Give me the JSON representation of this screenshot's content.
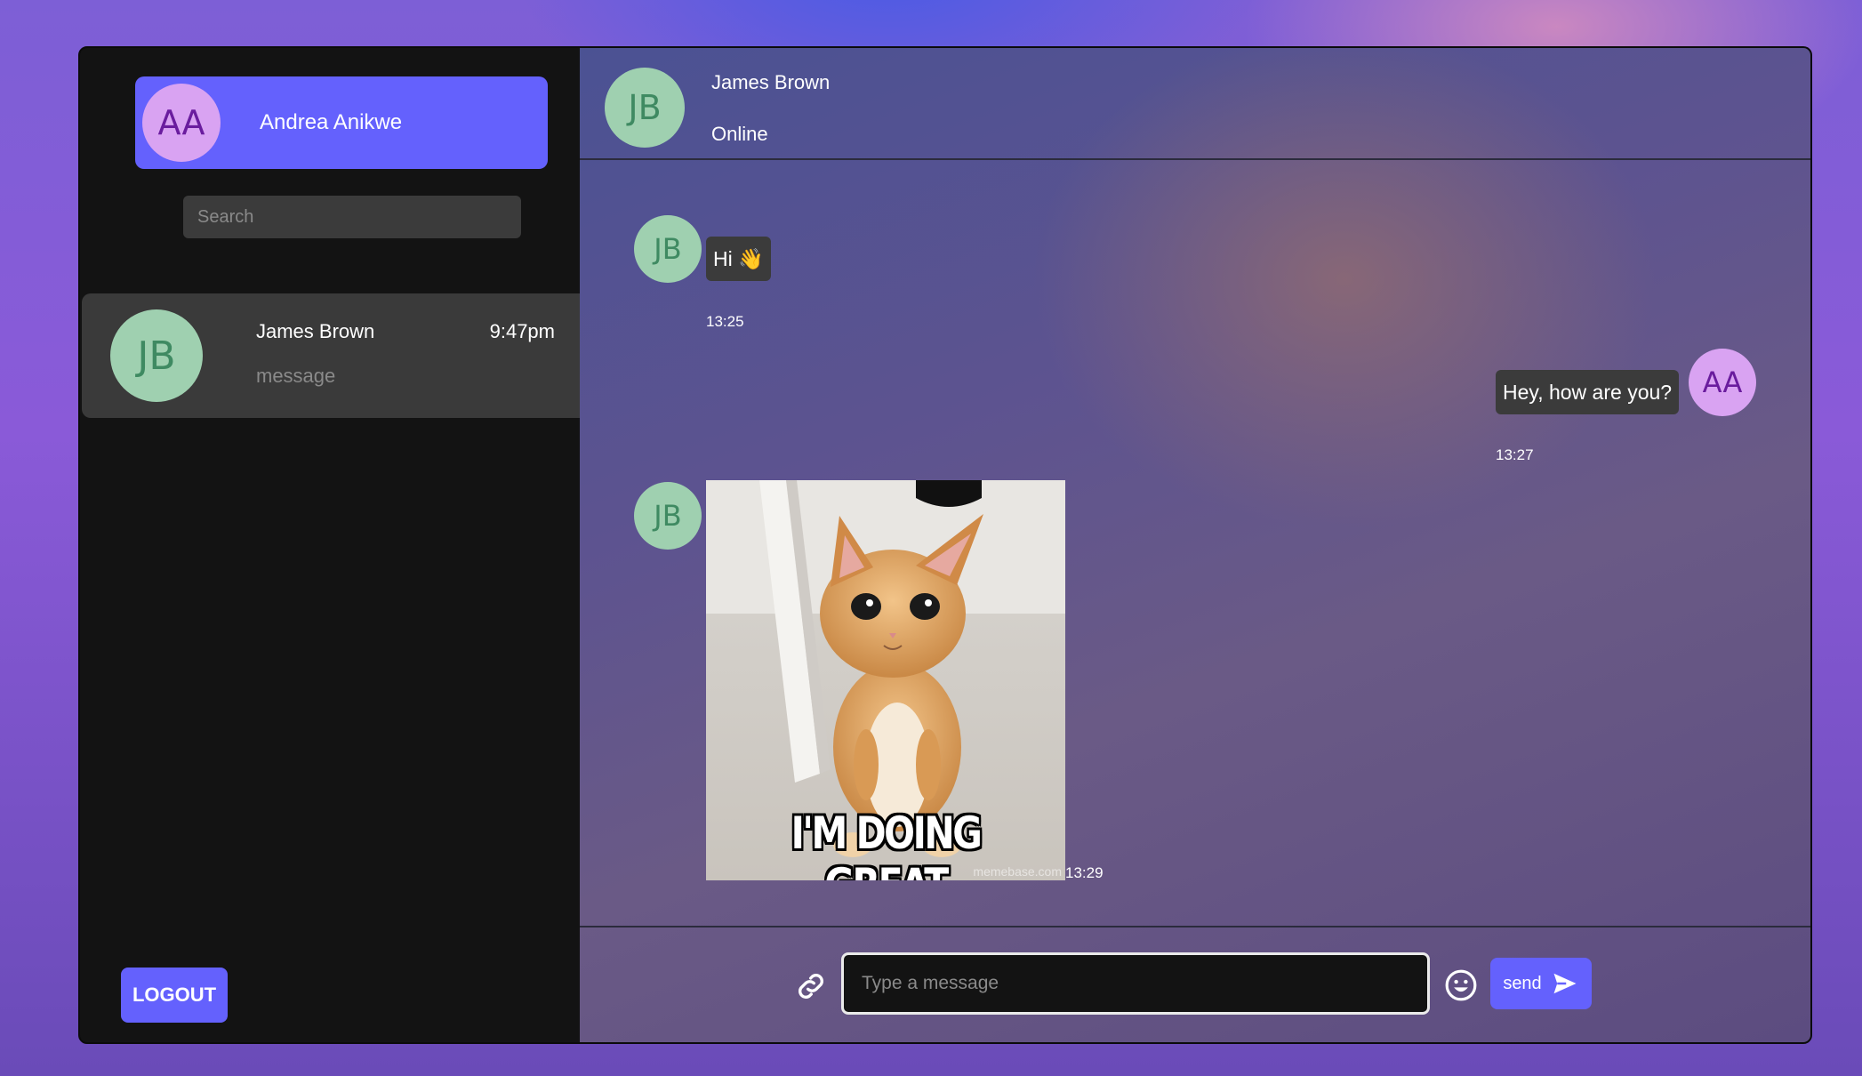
{
  "sidebar": {
    "me": {
      "initials": "AA",
      "name": "Andrea Anikwe"
    },
    "search_placeholder": "Search",
    "contacts": [
      {
        "initials": "JB",
        "name": "James Brown",
        "time": "9:47pm",
        "preview": "message"
      }
    ],
    "logout_label": "LOGOUT"
  },
  "chat": {
    "header": {
      "initials": "JB",
      "name": "James Brown",
      "status": "Online"
    },
    "messages": [
      {
        "sender": "JB",
        "text": "Hi 👋",
        "time": "13:25"
      },
      {
        "sender": "AA",
        "text": "Hey, how are you?",
        "time": "13:27"
      },
      {
        "sender": "JB",
        "type": "image",
        "image_caption": "I'M DOING GREAT",
        "watermark": "memebase.com",
        "time": "13:29"
      }
    ],
    "composer": {
      "placeholder": "Type a message",
      "send_label": "send"
    }
  },
  "icons": {
    "attach": "link-icon",
    "emoji": "smiley-icon",
    "send": "paper-plane-icon"
  },
  "colors": {
    "accent": "#6461fd",
    "avatar_aa_bg": "#d9a3f2",
    "avatar_jb_bg": "#9fd0b0",
    "sidebar_bg": "#131313",
    "bubble_bg": "#3b3b3b"
  }
}
